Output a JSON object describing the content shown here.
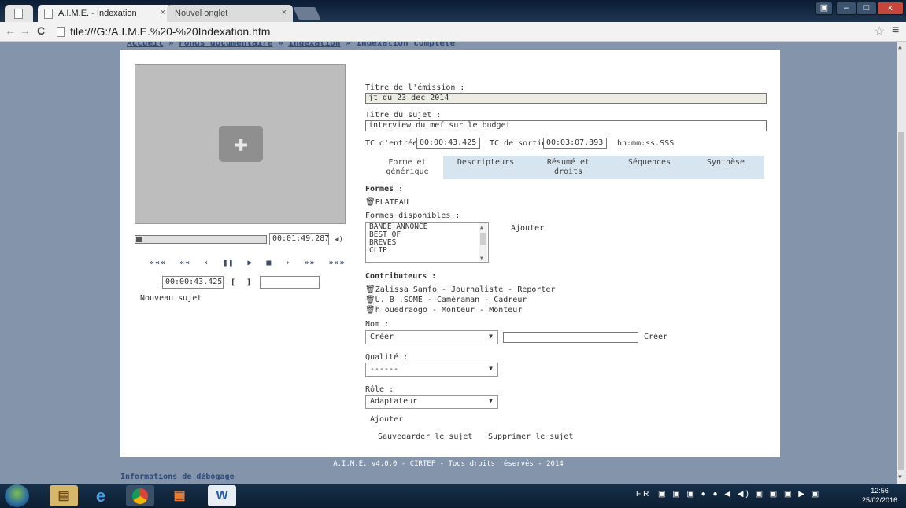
{
  "browser": {
    "tab1_title": "A.I.M.E. - Indexation",
    "tab2_title": "Nouvel onglet",
    "tab_close": "×",
    "url": "file:///G:/A.I.M.E.%20-%20Indexation.htm",
    "back": "←",
    "forward": "→",
    "reload": "C",
    "star": "☆",
    "menu": "≡",
    "minimize": "–",
    "maximize": "□",
    "close": "x"
  },
  "breadcrumb": {
    "home": "Accueil",
    "sep": "»",
    "fonds": "Fonds documentaire",
    "indexation": "Indexation",
    "current": "Indexation complète"
  },
  "player": {
    "duration": "00:01:49.287",
    "controls": [
      "«««",
      "««",
      "‹",
      "❚❚",
      "▶",
      "■",
      "›",
      "»»",
      "»»»"
    ],
    "tc_in": "00:00:43.425",
    "bracket_open": "[",
    "bracket_close": "]",
    "tc_out": "",
    "new_subject": "Nouveau sujet"
  },
  "form": {
    "title_label": "Titre de l'émission :",
    "title_value": "jt du 23 dec 2014",
    "subject_label": "Titre du sujet :",
    "subject_value": "interview du mef sur le budget",
    "tc_in_label": "TC d'entrée :",
    "tc_in_value": "00:00:43.425",
    "tc_out_label": "TC de sortie :",
    "tc_out_value": "00:03:07.393",
    "tc_format": "hh:mm:ss.SSS"
  },
  "tabs": [
    {
      "label": "Forme et générique",
      "line1": "Forme et",
      "line2": "générique"
    },
    {
      "label": "Descripteurs"
    },
    {
      "label": "Résumé et droits",
      "line1": "Résumé et",
      "line2": "droits"
    },
    {
      "label": "Séquences"
    },
    {
      "label": "Synthèse"
    }
  ],
  "formes": {
    "heading": "Formes :",
    "items": [
      "PLATEAU"
    ],
    "available_label": "Formes disponibles :",
    "available": [
      "BANDE ANNONCE",
      "BEST OF",
      "BREVES",
      "CLIP"
    ],
    "add": "Ajouter"
  },
  "contributeurs": {
    "heading": "Contributeurs :",
    "items": [
      "Zalissa Sanfo - Journaliste - Reporter",
      "U. B .SOME - Caméraman - Cadreur",
      "h ouedraogo - Monteur - Monteur"
    ],
    "nom_label": "Nom :",
    "nom_value": "Créer",
    "nom_input": "",
    "create": "Créer",
    "qualite_label": "Qualité :",
    "qualite_value": "------",
    "role_label": "Rôle :",
    "role_value": "Adaptateur",
    "add": "Ajouter"
  },
  "actions": {
    "save": "Sauvegarder le sujet",
    "delete": "Supprimer le sujet"
  },
  "footer": {
    "copyright": "A.I.M.E. v4.0.0 - CIRTEF - Tous droits réservés - 2014",
    "debug": "Informations de débogage"
  },
  "taskbar": {
    "lang": "FR",
    "time": "12:56",
    "date": "25/02/2016"
  },
  "colors": {
    "page_bg": "#8394ab",
    "tab_bar": "#d7e5f0",
    "link": "#2f4a76"
  }
}
